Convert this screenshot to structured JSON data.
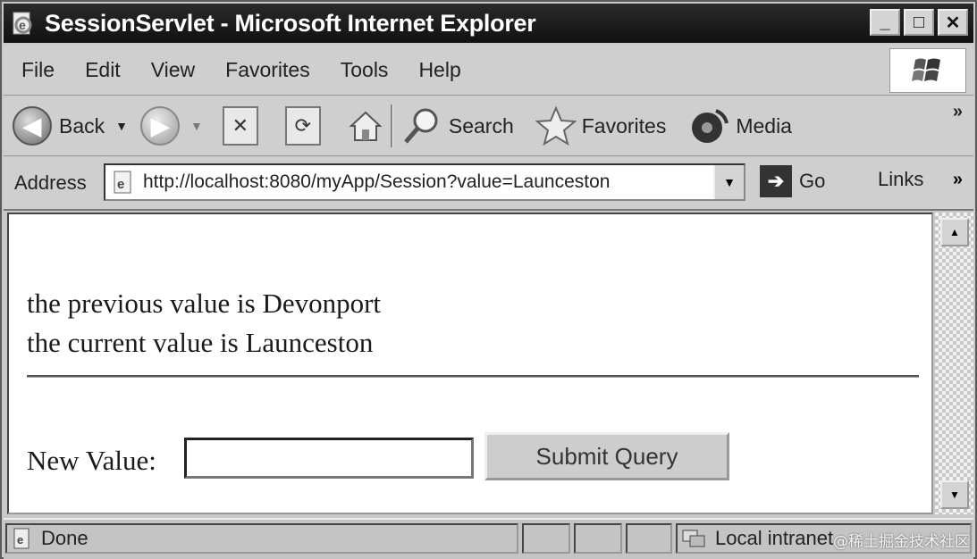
{
  "window": {
    "title": "SessionServlet - Microsoft Internet Explorer",
    "controls": {
      "minimize": "_",
      "maximize": "□",
      "close": "✕"
    }
  },
  "menu": [
    "File",
    "Edit",
    "View",
    "Favorites",
    "Tools",
    "Help"
  ],
  "toolbar": {
    "back_label": "Back",
    "search_label": "Search",
    "favorites_label": "Favorites",
    "media_label": "Media",
    "more": "»"
  },
  "address": {
    "label": "Address",
    "url": "http://localhost:8080/myApp/Session?value=Launceston",
    "go_label": "Go",
    "links_label": "Links",
    "more": "»"
  },
  "page": {
    "previous_line": "the previous value is Devonport",
    "current_line": "the current value is Launceston",
    "new_value_label": "New Value:",
    "new_value_input": "",
    "submit_label": "Submit Query"
  },
  "status": {
    "text": "Done",
    "zone": "Local intranet"
  },
  "watermark": "@稀土掘金技术社区"
}
